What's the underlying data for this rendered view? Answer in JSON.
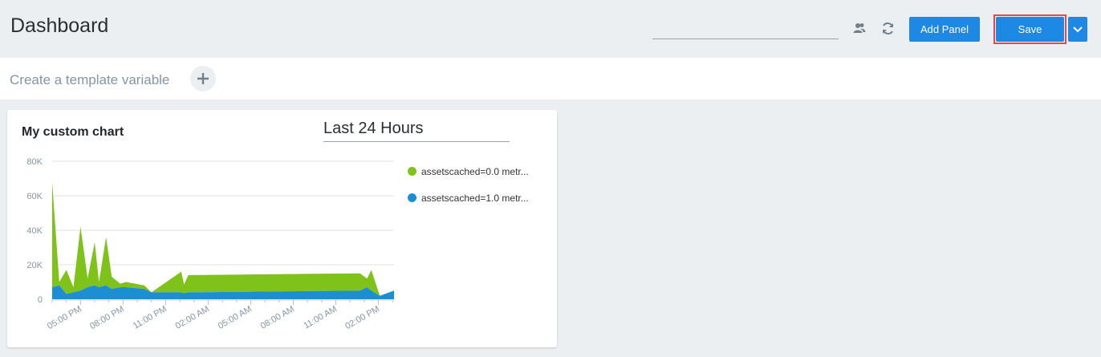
{
  "header": {
    "title": "Dashboard",
    "search_value": "",
    "add_panel_label": "Add Panel",
    "save_label": "Save"
  },
  "template_bar": {
    "label": "Create a template variable"
  },
  "panel": {
    "title": "My custom chart",
    "time_range": "Last 24 Hours"
  },
  "colors": {
    "accent": "#1e88e5",
    "series_green": "#7ec21a",
    "series_blue": "#1b8fd2"
  },
  "chart_data": {
    "type": "area",
    "stacked": true,
    "grid": true,
    "legend_position": "right",
    "ylim": [
      0,
      80000
    ],
    "y_ticks": [
      "0",
      "20K",
      "40K",
      "60K",
      "80K"
    ],
    "x_tick_labels": [
      "05:00 PM",
      "08:00 PM",
      "11:00 PM",
      "02:00 AM",
      "05:00 AM",
      "08:00 AM",
      "11:00 AM",
      "02:00 PM"
    ],
    "x_hours": [
      0,
      0.5,
      1,
      1.5,
      2,
      2.5,
      3,
      3.3,
      3.8,
      4.2,
      4.8,
      5.2,
      6.5,
      7,
      9.1,
      9.3,
      9.6,
      21.7,
      22.2,
      22.5,
      23.1,
      24.1
    ],
    "series": [
      {
        "name": "assetscached=0.0 metr...",
        "values": [
          61000,
          2000,
          14000,
          3000,
          37000,
          5000,
          25000,
          3000,
          28000,
          7000,
          2000,
          3000,
          2000,
          0,
          12000,
          5000,
          10000,
          10000,
          5000,
          12000,
          0,
          0
        ]
      },
      {
        "name": "assetscached=1.0 metr...",
        "values": [
          7000,
          8000,
          3000,
          4000,
          5000,
          7000,
          8000,
          7000,
          8000,
          6000,
          7000,
          7000,
          6000,
          4000,
          4000,
          3500,
          4000,
          5000,
          7000,
          5000,
          2000,
          5000
        ]
      }
    ]
  }
}
